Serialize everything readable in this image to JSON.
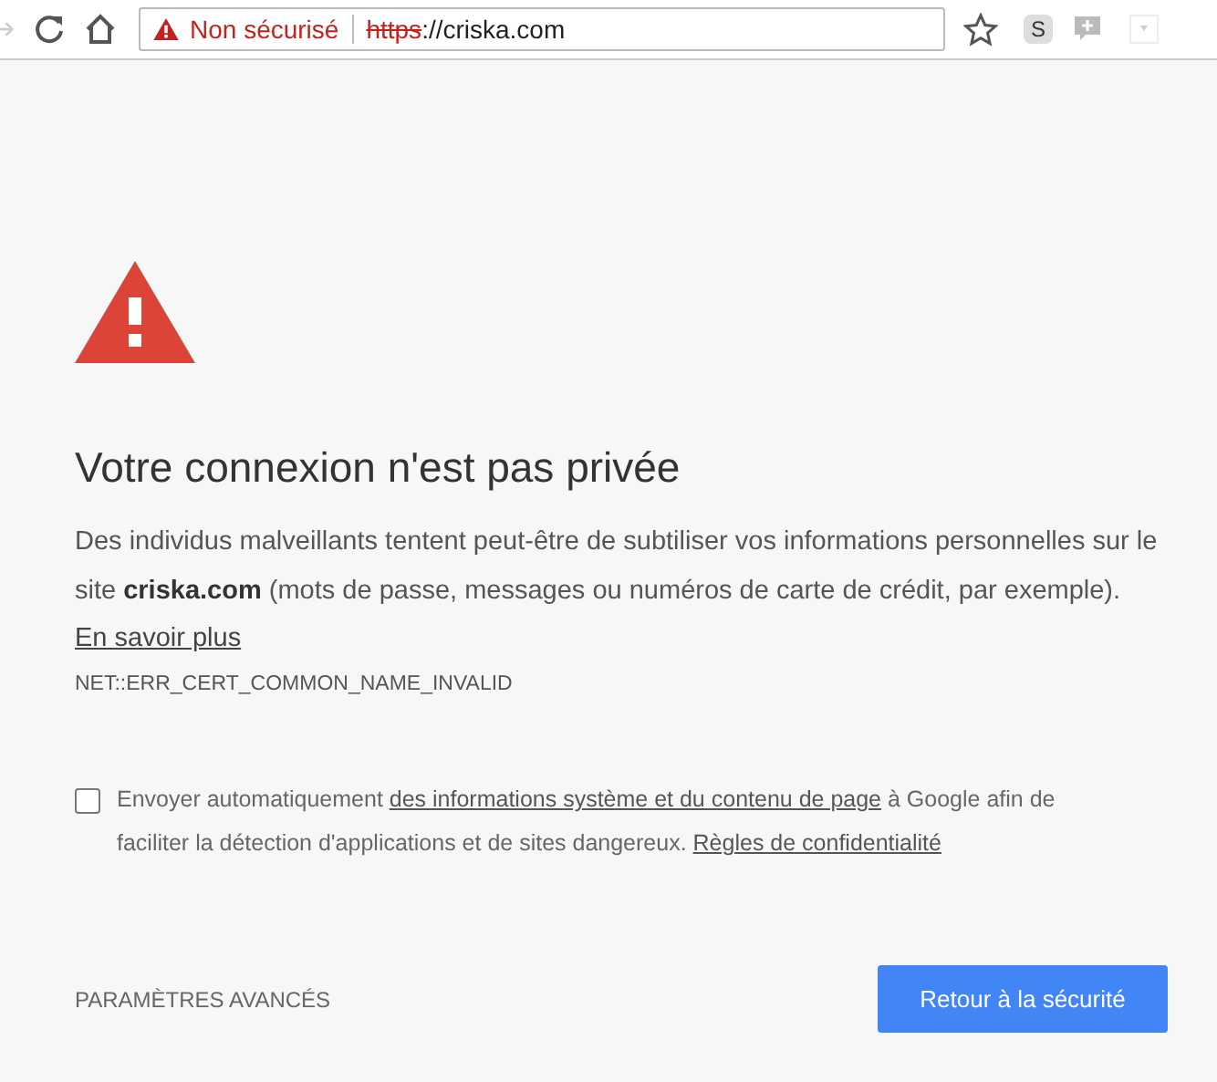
{
  "toolbar": {
    "forward_disabled": true,
    "security_label": "Non sécurisé",
    "url_scheme": "https",
    "url_rest": "://criska.com",
    "scheme_struck": true,
    "extension_letter": "S"
  },
  "interstitial": {
    "title": "Votre connexion n'est pas privée",
    "description": "Des individus malveillants tentent peut-être de subtiliser vos informations personnelles sur le site **criska.com** (mots de passe, messages ou numéros de carte de crédit, par exemple).",
    "learn_more": "En savoir plus",
    "error_code": "NET::ERR_CERT_COMMON_NAME_INVALID",
    "report": {
      "checked": false,
      "parts": [
        {
          "kind": "text",
          "text": "Envoyer automatiquement "
        },
        {
          "kind": "link",
          "text": "des informations système et du contenu de page"
        },
        {
          "kind": "text",
          "text": " à Google afin de faciliter la détection d'applications et de sites dangereux. "
        },
        {
          "kind": "link",
          "text": "Règles de confidentialité"
        }
      ]
    },
    "advanced": "PARAMÈTRES AVANCÉS",
    "back_button": "Retour à la sécurité"
  }
}
